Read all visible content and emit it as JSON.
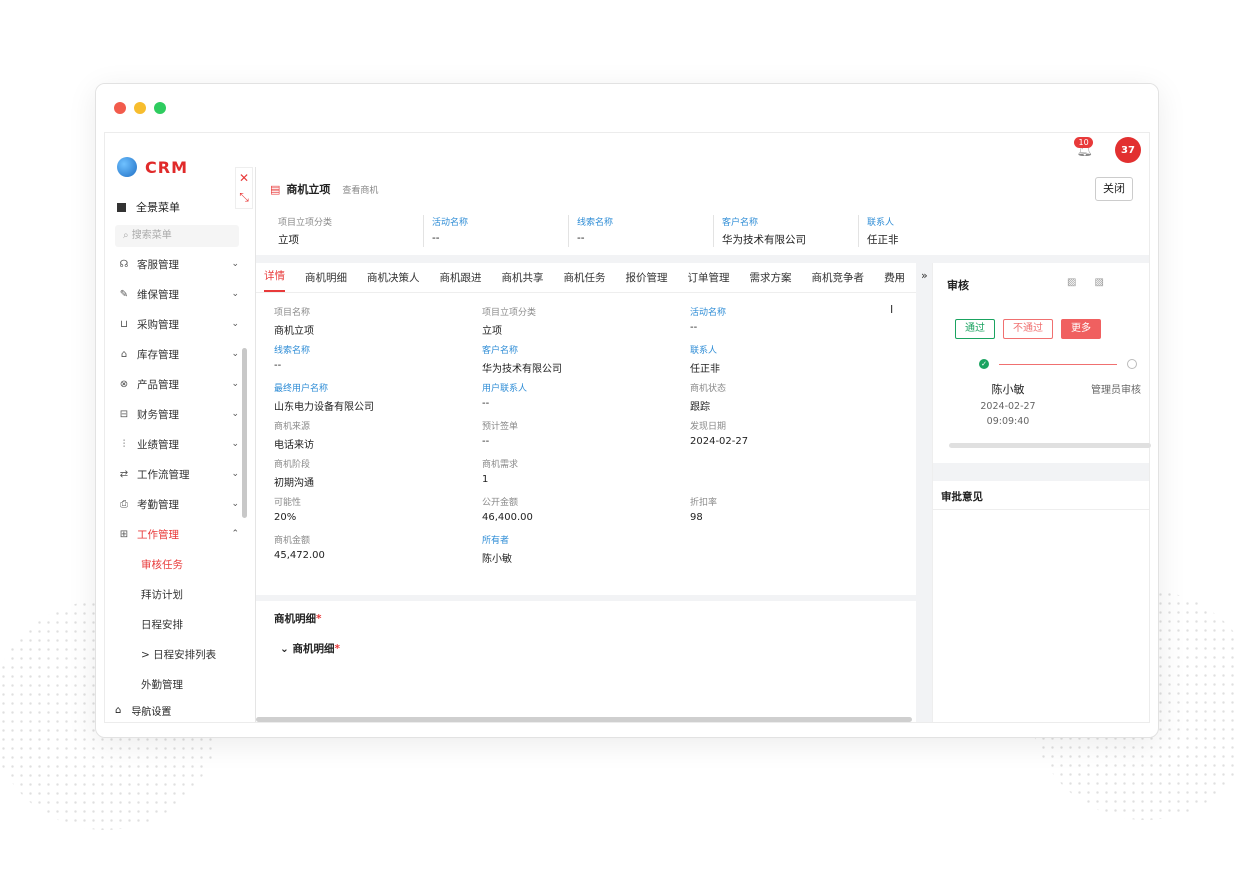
{
  "window": {
    "dots": [
      "#f25b4c",
      "#f7bd2e",
      "#2ecc5f"
    ]
  },
  "app": {
    "logo": "CRM",
    "menu_all": "全景菜单",
    "search_placeholder": "搜索菜单",
    "nav": [
      {
        "label": "客服管理",
        "icon": "headset-icon",
        "glyph": "☊"
      },
      {
        "label": "维保管理",
        "icon": "wrench-icon",
        "glyph": "✎"
      },
      {
        "label": "采购管理",
        "icon": "cart-icon",
        "glyph": "⊔"
      },
      {
        "label": "库存管理",
        "icon": "warehouse-icon",
        "glyph": "⌂"
      },
      {
        "label": "产品管理",
        "icon": "box-icon",
        "glyph": "⊗"
      },
      {
        "label": "财务管理",
        "icon": "wallet-icon",
        "glyph": "⊟"
      },
      {
        "label": "业绩管理",
        "icon": "chart-icon",
        "glyph": "⫶"
      },
      {
        "label": "工作流管理",
        "icon": "flow-icon",
        "glyph": "⇄"
      },
      {
        "label": "考勤管理",
        "icon": "clock-icon",
        "glyph": "⎙"
      },
      {
        "label": "工作管理",
        "icon": "grid-icon",
        "glyph": "⊞"
      }
    ],
    "sub_nav": [
      "审核任务",
      "拜访计划",
      "日程安排",
      "> 日程安排列表",
      "外勤管理"
    ],
    "bottom_nav": "导航设置",
    "notifications": "10",
    "avatar_text": "37"
  },
  "panel": {
    "title": "商机立项",
    "subtitle": "查看商机",
    "close_label": "关闭",
    "summary": [
      {
        "label": "项目立项分类",
        "value": "立项",
        "blue": false
      },
      {
        "label": "活动名称",
        "value": "--",
        "blue": true
      },
      {
        "label": "线索名称",
        "value": "--",
        "blue": true
      },
      {
        "label": "客户名称",
        "value": "华为技术有限公司",
        "blue": true
      },
      {
        "label": "联系人",
        "value": "任正非",
        "blue": true
      }
    ],
    "tabs": [
      "详情",
      "商机明细",
      "商机决策人",
      "商机跟进",
      "商机共享",
      "商机任务",
      "报价管理",
      "订单管理",
      "需求方案",
      "商机竞争者",
      "费用"
    ],
    "tab_more": "···",
    "fields": [
      {
        "label": "项目名称",
        "value": "商机立项",
        "blue": false
      },
      {
        "label": "项目立项分类",
        "value": "立项",
        "blue": false
      },
      {
        "label": "活动名称",
        "value": "--",
        "blue": true
      },
      {
        "label": "线索名称",
        "value": "--",
        "blue": true
      },
      {
        "label": "客户名称",
        "value": "华为技术有限公司",
        "blue": true
      },
      {
        "label": "联系人",
        "value": "任正非",
        "blue": true
      },
      {
        "label": "最终用户名称",
        "value": "山东电力设备有限公司",
        "blue": true
      },
      {
        "label": "用户联系人",
        "value": "--",
        "blue": true
      },
      {
        "label": "商机状态",
        "value": "跟踪",
        "blue": false
      },
      {
        "label": "商机来源",
        "value": "电话来访",
        "blue": false
      },
      {
        "label": "预计签单",
        "value": "--",
        "blue": false
      },
      {
        "label": "发现日期",
        "value": "2024-02-27",
        "blue": false
      },
      {
        "label": "商机阶段",
        "value": "初期沟通",
        "blue": false
      },
      {
        "label": "商机需求",
        "value": "1",
        "blue": false
      },
      {
        "label": "",
        "value": "",
        "blue": false
      },
      {
        "label": "可能性",
        "value": "20%",
        "blue": false
      },
      {
        "label": "公开金额",
        "value": "46,400.00",
        "blue": false
      },
      {
        "label": "折扣率",
        "value": "98",
        "blue": false
      },
      {
        "label": "商机金额",
        "value": "45,472.00",
        "blue": false
      },
      {
        "label": "所有者",
        "value": "陈小敏",
        "blue": true
      },
      {
        "label": "",
        "value": "",
        "blue": false
      }
    ],
    "detail_title": "商机明细",
    "detail_sub": "商机明细",
    "required_mark": "*"
  },
  "review": {
    "title": "审核",
    "buttons": {
      "pass": "通过",
      "fail": "不通过",
      "more": "更多"
    },
    "step1": {
      "name": "陈小敏",
      "date": "2024-02-27",
      "time": "09:09:40"
    },
    "step2": "管理员审核",
    "opinion_title": "审批意见"
  }
}
